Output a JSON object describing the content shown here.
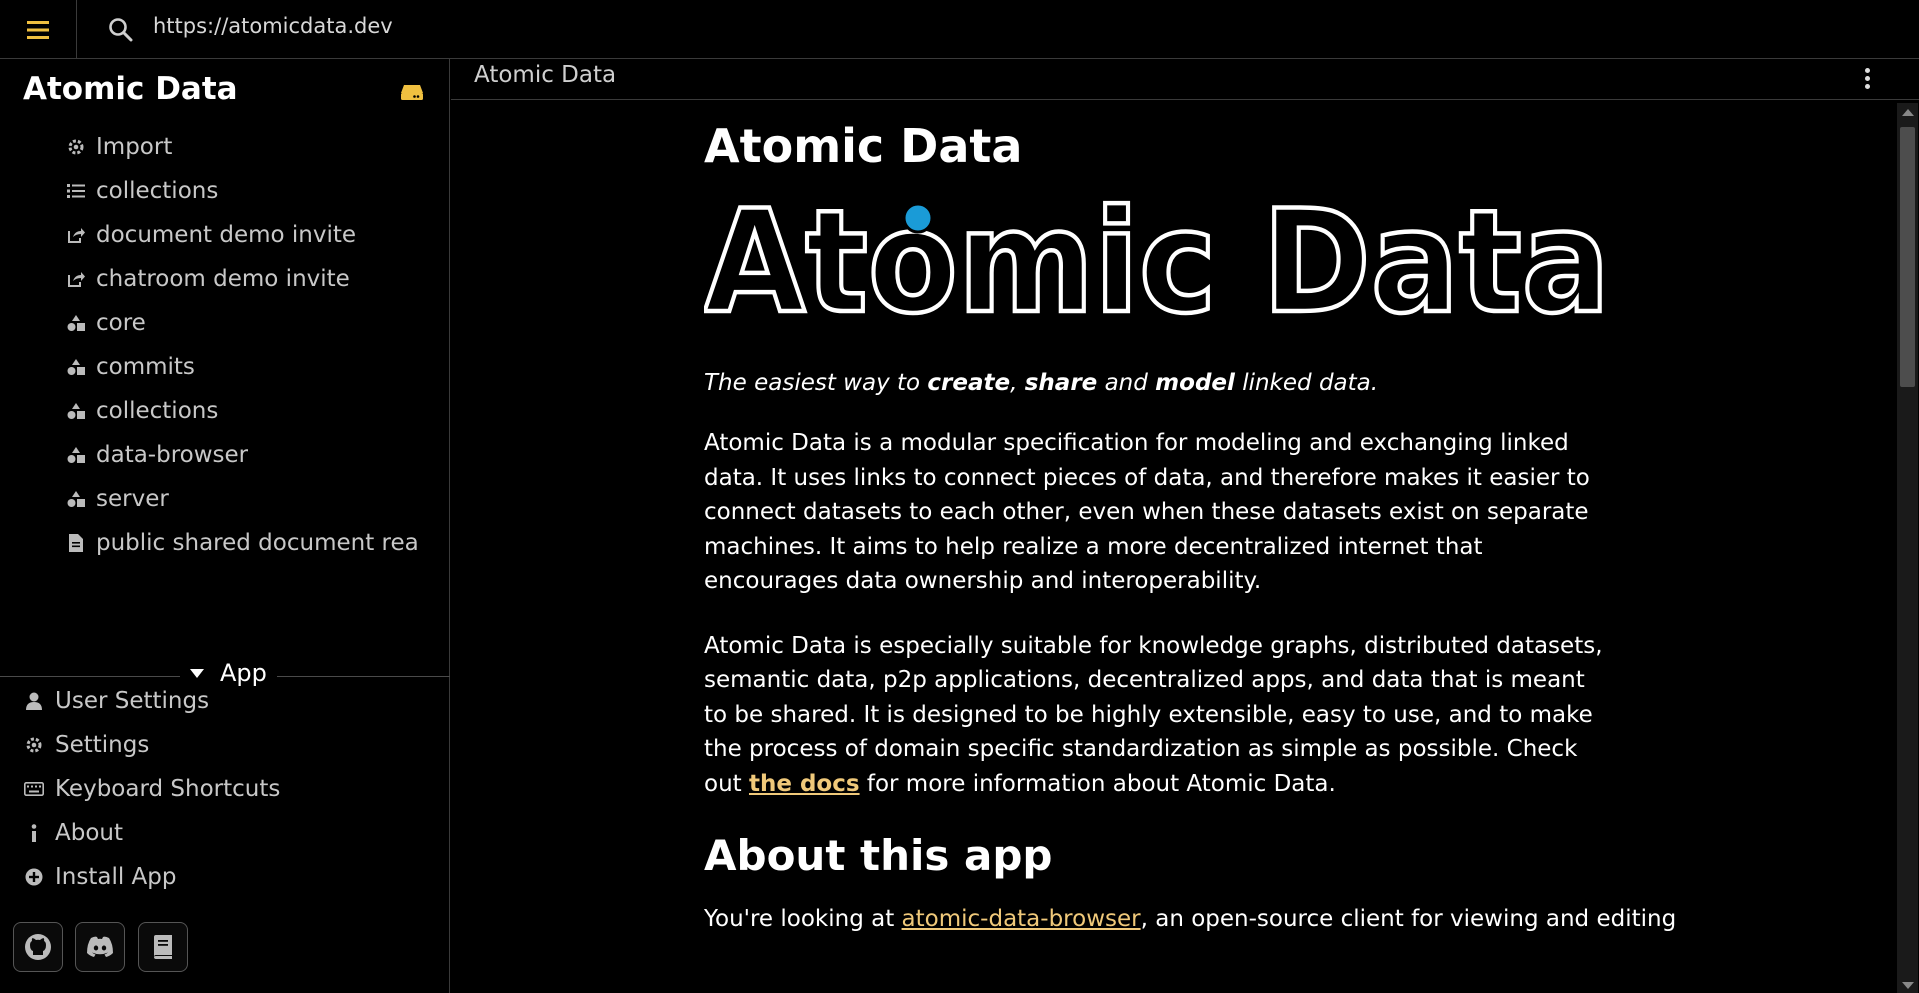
{
  "topbar": {
    "address": "https://atomicdata.dev",
    "accent": "#f0c040"
  },
  "sidebar": {
    "drive_title": "Atomic Data",
    "items": [
      {
        "label": "Import",
        "icon": "gear-icon"
      },
      {
        "label": "collections",
        "icon": "list-icon"
      },
      {
        "label": "document demo invite",
        "icon": "share-icon"
      },
      {
        "label": "chatroom demo invite",
        "icon": "share-icon"
      },
      {
        "label": "core",
        "icon": "shapes-icon"
      },
      {
        "label": "commits",
        "icon": "shapes-icon"
      },
      {
        "label": "collections",
        "icon": "shapes-icon"
      },
      {
        "label": "data-browser",
        "icon": "shapes-icon"
      },
      {
        "label": "server",
        "icon": "shapes-icon"
      },
      {
        "label": "public shared document rea",
        "icon": "file-icon"
      }
    ],
    "app_section": "App",
    "app_items": [
      {
        "label": "User Settings",
        "icon": "user-icon"
      },
      {
        "label": "Settings",
        "icon": "gear-icon"
      },
      {
        "label": "Keyboard Shortcuts",
        "icon": "keyboard-icon"
      },
      {
        "label": "About",
        "icon": "info-icon"
      },
      {
        "label": "Install App",
        "icon": "plus-circle-icon"
      }
    ],
    "social": [
      "github-icon",
      "discord-icon",
      "book-icon"
    ]
  },
  "main": {
    "breadcrumb": "Atomic Data",
    "title": "Atomic Data",
    "logo_text": "Atomic Data",
    "tagline": {
      "pre": "The easiest way to ",
      "w1": "create",
      "sep1": ", ",
      "w2": "share",
      "sep2": " and ",
      "w3": "model",
      "post": " linked data."
    },
    "para1": "Atomic Data is a modular specification for modeling and exchanging linked data. It uses links to connect pieces of data, and therefore makes it easier to connect datasets to each other, even when these datasets exist on separate machines. It aims to help realize a more decentralized internet that encourages data ownership and interoperability.",
    "para2_pre": "Atomic Data is especially suitable for knowledge graphs, distributed datasets, semantic data, p2p applications, decentralized apps, and data that is meant to be shared. It is designed to be highly extensible, easy to use, and to make the process of domain specific standardization as simple as possible. Check out ",
    "para2_link": "the docs",
    "para2_post": " for more information about Atomic Data.",
    "section_title": "About this app",
    "para3_pre": "You're looking at ",
    "para3_link": "atomic-data-browser",
    "para3_post": ", an open-source client for viewing and editing"
  }
}
